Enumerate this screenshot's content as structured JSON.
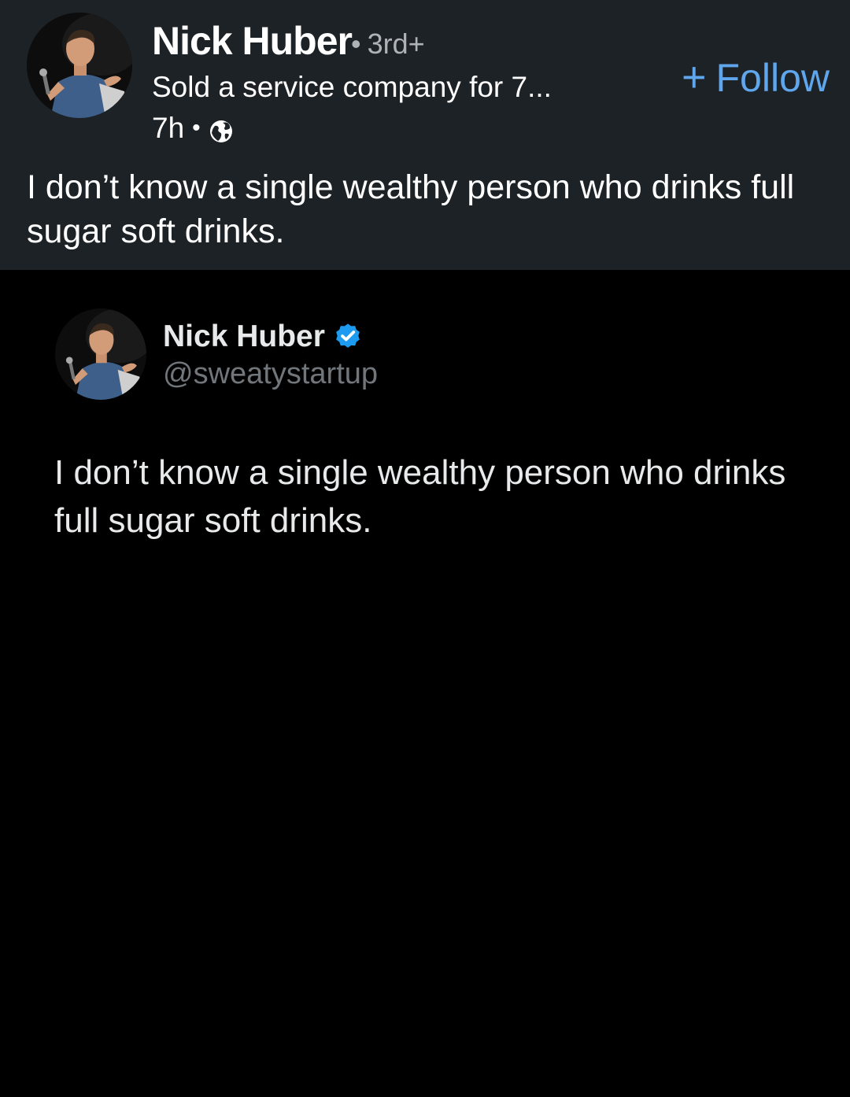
{
  "post": {
    "author_name": "Nick Huber",
    "degree_separator": "•",
    "degree": "3rd+",
    "headline": "Sold a service company for 7...",
    "time": "7h",
    "meta_separator": "•",
    "visibility_icon": "globe-icon",
    "follow_plus": "+",
    "follow_label": "Follow",
    "text": "I don’t know a single wealthy person who drinks full sugar soft drinks."
  },
  "tweet": {
    "name": "Nick Huber",
    "verified_icon": "verified-badge-icon",
    "handle": "@sweatystartup",
    "text": "I don’t know a single wealthy person who drinks full sugar soft drinks."
  },
  "colors": {
    "post_background": "#1d2226",
    "media_background": "#000000",
    "follow_accent": "#5fa6ec",
    "verified_blue": "#1d9bf0",
    "secondary_text": "#b0b3b6",
    "handle_gray": "#71767b"
  }
}
